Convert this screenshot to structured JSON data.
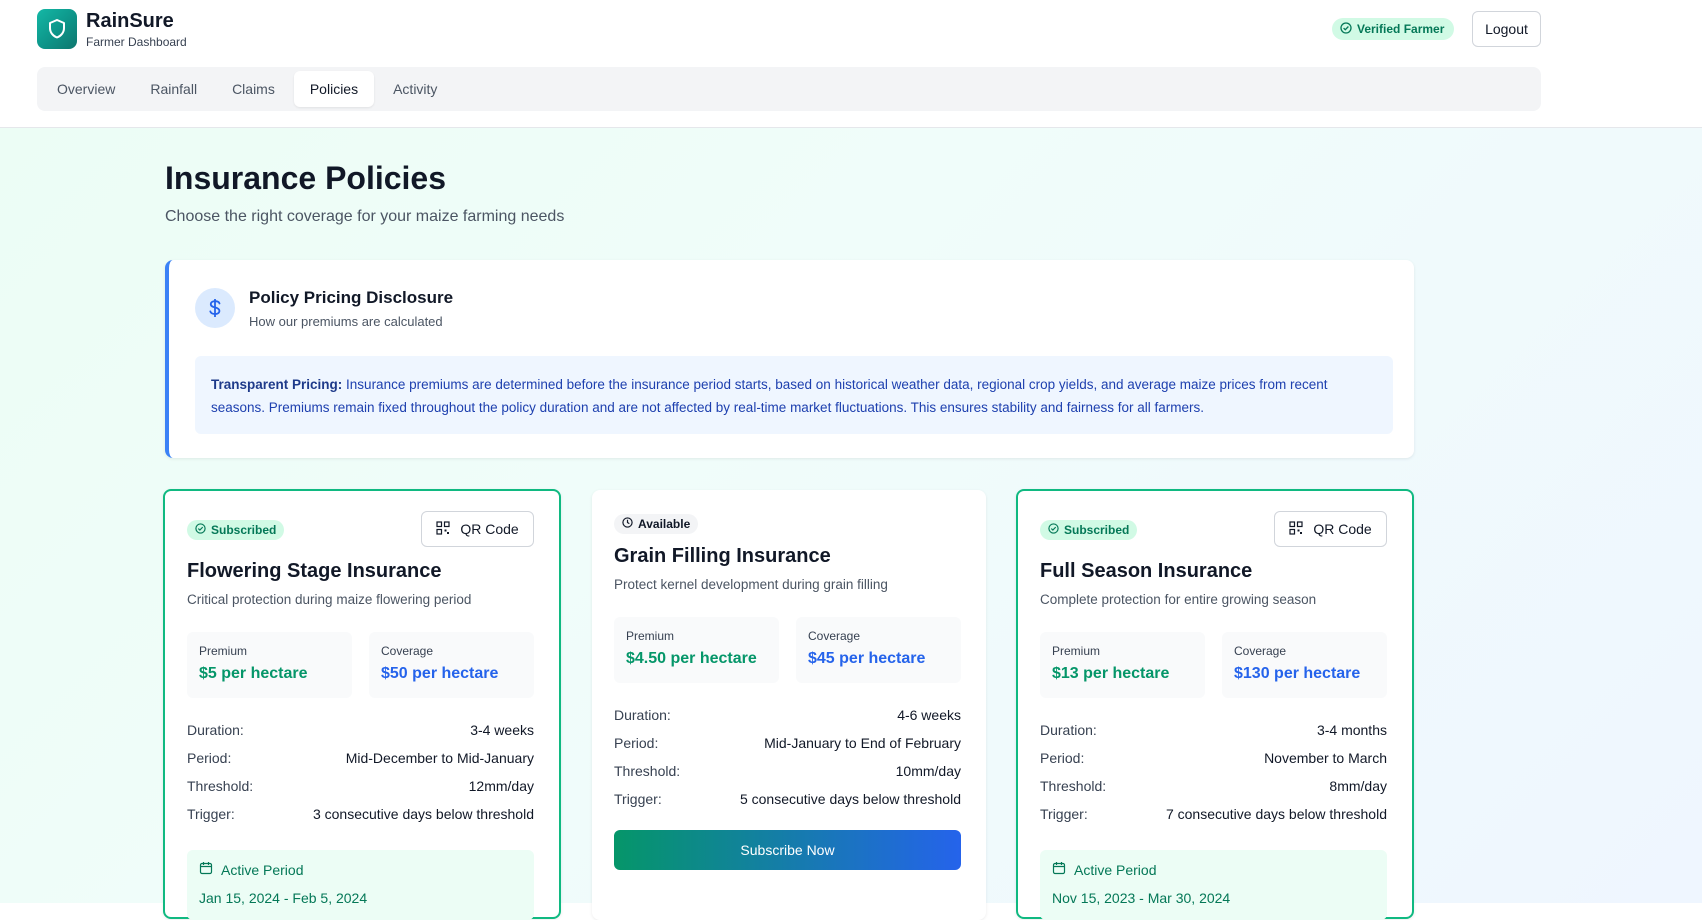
{
  "app": {
    "name": "RainSure",
    "subtitle": "Farmer Dashboard"
  },
  "header": {
    "verified_label": "Verified Farmer",
    "logout_label": "Logout"
  },
  "tabs": [
    {
      "label": "Overview"
    },
    {
      "label": "Rainfall"
    },
    {
      "label": "Claims"
    },
    {
      "label": "Policies"
    },
    {
      "label": "Activity"
    }
  ],
  "active_tab": "Policies",
  "page": {
    "title": "Insurance Policies",
    "subtitle": "Choose the right coverage for your maize farming needs"
  },
  "disclosure": {
    "title": "Policy Pricing Disclosure",
    "subtitle": "How our premiums are calculated",
    "lead": "Transparent Pricing:",
    "body": " Insurance premiums are determined before the insurance period starts, based on historical weather data, regional crop yields, and average maize prices from recent seasons. Premiums remain fixed throughout the policy duration and are not affected by real-time market fluctuations. This ensures stability and fairness for all farmers."
  },
  "labels": {
    "premium": "Premium",
    "coverage": "Coverage",
    "duration": "Duration:",
    "period": "Period:",
    "threshold": "Threshold:",
    "trigger": "Trigger:",
    "qr_code": "QR Code",
    "active_period": "Active Period",
    "subscribe": "Subscribe Now"
  },
  "policies": [
    {
      "status": "Subscribed",
      "title": "Flowering Stage Insurance",
      "description": "Critical protection during maize flowering period",
      "premium": "$5 per hectare",
      "coverage": "$50 per hectare",
      "duration": "3-4 weeks",
      "period": "Mid-December to Mid-January",
      "threshold": "12mm/day",
      "trigger": "3 consecutive days below threshold",
      "active_dates": "Jan 15, 2024 - Feb 5, 2024"
    },
    {
      "status": "Available",
      "title": "Grain Filling Insurance",
      "description": "Protect kernel development during grain filling",
      "premium": "$4.50 per hectare",
      "coverage": "$45 per hectare",
      "duration": "4-6 weeks",
      "period": "Mid-January to End of February",
      "threshold": "10mm/day",
      "trigger": "5 consecutive days below threshold"
    },
    {
      "status": "Subscribed",
      "title": "Full Season Insurance",
      "description": "Complete protection for entire growing season",
      "premium": "$13 per hectare",
      "coverage": "$130 per hectare",
      "duration": "3-4 months",
      "period": "November to March",
      "threshold": "8mm/day",
      "trigger": "7 consecutive days below threshold",
      "active_dates": "Nov 15, 2023 - Mar 30, 2024"
    }
  ],
  "colors": {
    "accent_green": "#10b981",
    "accent_blue": "#2563eb",
    "premium_text": "#059669"
  }
}
